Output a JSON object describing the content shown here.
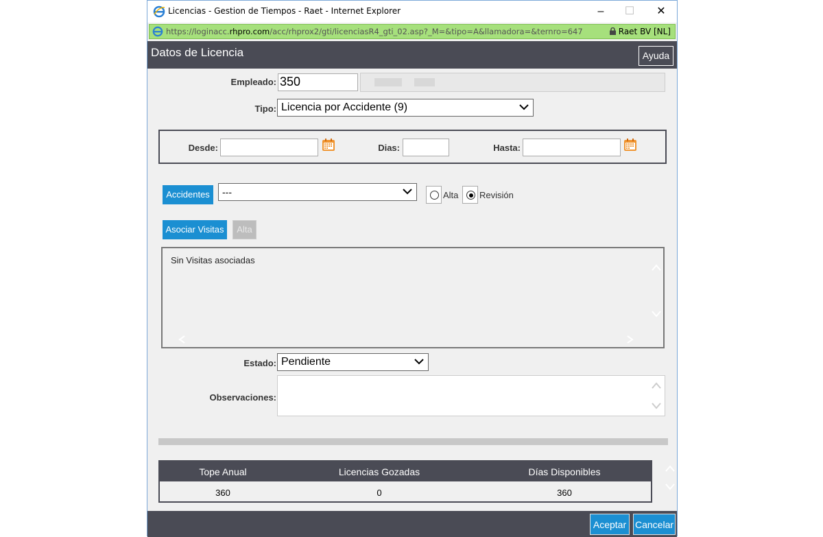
{
  "window": {
    "title": "Licencias - Gestion de Tiempos - Raet - Internet Explorer",
    "url_prefix": "https://loginacc.",
    "url_domain": "rhpro.com",
    "url_suffix": "/acc/rhprox2/gti/licenciasR4_gti_02.asp?_M=&tipo=A&llamadora=&ternro=647",
    "site_identity": "Raet BV [NL]"
  },
  "header": {
    "title": "Datos de Licencia",
    "help_label": "Ayuda"
  },
  "form": {
    "empleado_label": "Empleado:",
    "empleado_value": "350",
    "tipo_label": "Tipo:",
    "tipo_value": "Licencia por Accidente (9)",
    "desde_label": "Desde:",
    "desde_value": "",
    "dias_label": "Dias:",
    "dias_value": "",
    "hasta_label": "Hasta:",
    "hasta_value": "",
    "accidentes_label": "Accidentes",
    "accidentes_value": "---",
    "radio_alta": "Alta",
    "radio_revision": "Revisión",
    "radio_selected": "Revisión",
    "asociar_label": "Asociar Visitas",
    "alta_btn_label": "Alta",
    "visitas_message": "Sin Visitas asociadas",
    "estado_label": "Estado:",
    "estado_value": "Pendiente",
    "observaciones_label": "Observaciones:",
    "observaciones_value": ""
  },
  "summary": {
    "headers": [
      "Tope Anual",
      "Licencias Gozadas",
      "Días Disponibles"
    ],
    "values": [
      "360",
      "0",
      "360"
    ]
  },
  "footer": {
    "accept_label": "Aceptar",
    "cancel_label": "Cancelar"
  },
  "colors": {
    "accent": "#1b8fd2",
    "header_bg": "#4a4b55",
    "address_bar": "#a6e07c",
    "calendar_icon": "#f0942e"
  }
}
